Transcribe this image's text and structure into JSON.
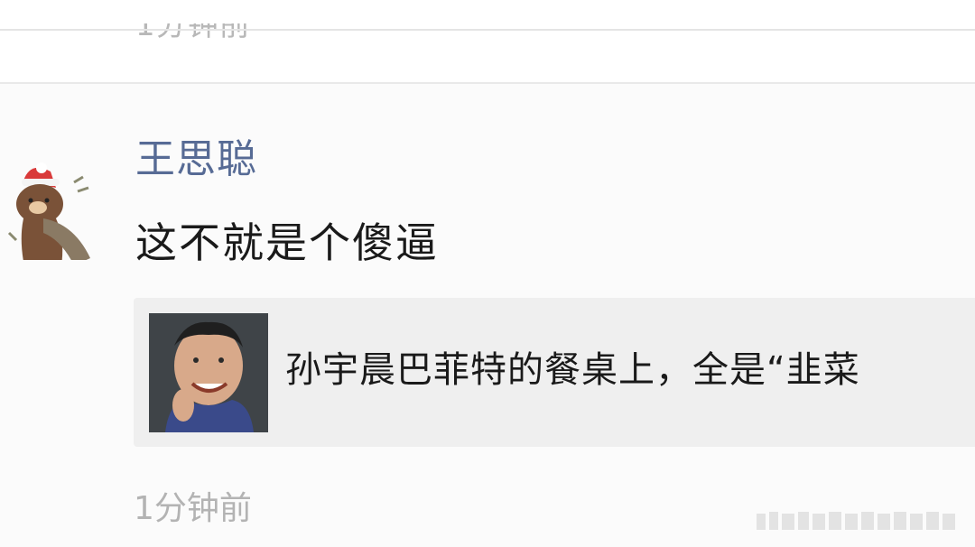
{
  "previous_post": {
    "timestamp_partial": "1分钟前"
  },
  "comment": {
    "avatar_icon": "bear-with-santa-hat-icon",
    "username": "王思聪",
    "text": "这不就是个傻逼",
    "link_card": {
      "thumbnail": "man-smiling-photo",
      "title": "孙宇晨巴菲特的餐桌上，全是“韭菜"
    },
    "timestamp": "1分钟前"
  },
  "colors": {
    "username": "#576b95",
    "text": "#1a1a1a",
    "timestamp": "#b3b3b3",
    "card_bg": "#efefef"
  }
}
